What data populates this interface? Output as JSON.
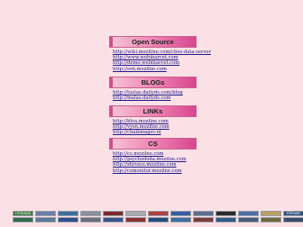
{
  "sections": [
    {
      "title": "Open Source",
      "links": [
        "http://wiki.moziline.com/cbos-data-server",
        "http://www.webinarcet.com",
        "http://demo.webinarcet.com",
        "http://svn.mozilne.com"
      ]
    },
    {
      "title": "BLOGs",
      "links": [
        "http://tuslas.dailyds.com/blog",
        "http://malas.dailyds.com"
      ]
    },
    {
      "title": "LINKs",
      "links": [
        "http://blva.mozilne.com",
        "http://vysn.mozilne.com",
        "http://chaikmagzs.nl"
      ]
    },
    {
      "title": "CS",
      "links": [
        "http://cs.mozilne.com",
        "http://psychzdoda.mozilne.com",
        "http://zhrosss.mozilne.com",
        "http://csmonitor.mozilne.com"
      ]
    }
  ],
  "badges_row1": [
    {
      "text": "LITHUANIA",
      "color": "#3d7a3a"
    },
    {
      "text": "",
      "color": "#6a7fa8"
    },
    {
      "text": "",
      "color": "#3e6ea0"
    },
    {
      "text": "",
      "color": "#8a8f99"
    },
    {
      "text": "",
      "color": "#7c2b2b"
    },
    {
      "text": "",
      "color": "#a8aab0"
    },
    {
      "text": "",
      "color": "#b04040"
    },
    {
      "text": "",
      "color": "#355fa5"
    },
    {
      "text": "",
      "color": "#5c6e8c"
    },
    {
      "text": "",
      "color": "#2a2a2a"
    },
    {
      "text": "",
      "color": "#4d6fa8"
    },
    {
      "text": "",
      "color": "#b8a060"
    },
    {
      "text": "EPIPHANY",
      "color": "#2f4f7a"
    }
  ],
  "badges_row2": [
    {
      "text": "",
      "color": "#2d6b4a"
    },
    {
      "text": "",
      "color": "#5a7a9a"
    },
    {
      "text": "",
      "color": "#2e4e8a"
    },
    {
      "text": "",
      "color": "#6b6e78"
    },
    {
      "text": "",
      "color": "#35558a"
    },
    {
      "text": "",
      "color": "#8a2f2f"
    },
    {
      "text": "",
      "color": "#244a7a"
    },
    {
      "text": "",
      "color": "#3e6ea0"
    },
    {
      "text": "",
      "color": "#7a3a3a"
    },
    {
      "text": "",
      "color": "#2e5a8a"
    },
    {
      "text": "",
      "color": "#4a5a7a"
    },
    {
      "text": "",
      "color": "#6a6a3a"
    },
    {
      "text": "",
      "color": "#3a4a6a"
    }
  ]
}
